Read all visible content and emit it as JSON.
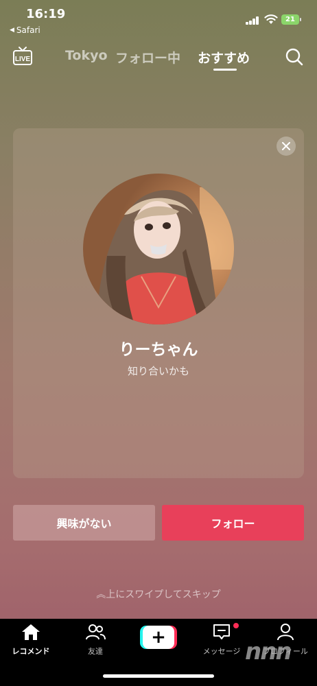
{
  "status": {
    "time": "16:19",
    "back_app": "Safari",
    "battery": "21"
  },
  "topnav": {
    "tabs": [
      "Tokyo",
      "フォロー中",
      "おすすめ"
    ],
    "active_tab": "おすすめ"
  },
  "card": {
    "name": "りーちゃん",
    "subtitle": "知り合いかも"
  },
  "buttons": {
    "not_interested": "興味がない",
    "follow": "フォロー"
  },
  "skip_hint": "上にスワイプしてスキップ",
  "bottom_nav": {
    "items": [
      "レコメンド",
      "友達",
      "",
      "メッセージ",
      "プロフィール"
    ],
    "active": "レコメンド"
  },
  "colors": {
    "follow": "#e8405a",
    "badge": "#fe2c55",
    "plus_left": "#25f4ee",
    "plus_right": "#fe2c55"
  },
  "icons": [
    "live-icon",
    "search-icon",
    "close-icon",
    "home-icon",
    "friends-icon",
    "plus-icon",
    "inbox-icon",
    "profile-icon"
  ]
}
